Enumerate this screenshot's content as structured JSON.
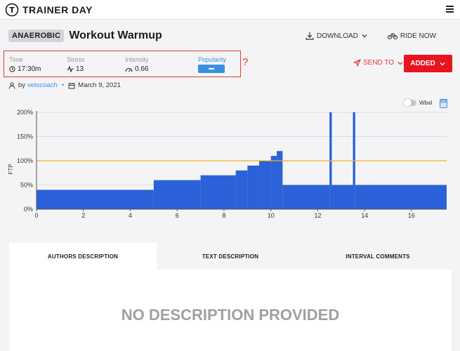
{
  "app": {
    "brand": "TRAINER DAY",
    "logo_letter": "T",
    "brand_color": "#1b1b1b",
    "accent_color": "#e8141f"
  },
  "workout": {
    "category": "ANAEROBIC",
    "title": "Workout Warmup",
    "author_prefix": "by",
    "author": "velocoach",
    "date": "March 9, 2021"
  },
  "actions": {
    "download": "DOWNLOAD",
    "ride_now": "RIDE NOW",
    "send_to": "SEND TO",
    "added": "ADDED"
  },
  "stats": {
    "time_label": "Time",
    "time_value": "17:30m",
    "stress_label": "Stress",
    "stress_value": "13",
    "intensity_label": "Intensity",
    "intensity_value": "0.66",
    "popularity_label": "Popularity",
    "annotation": "?"
  },
  "wbal": {
    "label": "Wbal",
    "enabled": false
  },
  "tabs": [
    {
      "label": "AUTHORS DESCRIPTION",
      "active": true
    },
    {
      "label": "TEXT DESCRIPTION",
      "active": false
    },
    {
      "label": "INTERVAL COMMENTS",
      "active": false
    }
  ],
  "description": {
    "empty_text": "NO DESCRIPTION PROVIDED"
  },
  "icons": [
    "download-icon",
    "bike-icon",
    "send-icon",
    "user-icon",
    "calendar-icon",
    "clock-icon",
    "pulse-icon",
    "gauge-icon",
    "calculator-icon",
    "menu-icon",
    "chevron-down-icon"
  ],
  "chart_data": {
    "type": "area",
    "ylabel": "FTP",
    "xlim": [
      0,
      17.5
    ],
    "ylim": [
      0,
      200
    ],
    "x_ticks": [
      0,
      2,
      4,
      6,
      8,
      10,
      12,
      14,
      16
    ],
    "y_ticks": [
      {
        "value": 0,
        "label": "0%"
      },
      {
        "value": 50,
        "label": "50%"
      },
      {
        "value": 100,
        "label": "100%"
      },
      {
        "value": 150,
        "label": "150%"
      },
      {
        "value": 200,
        "label": "200%"
      }
    ],
    "ftp_line": 100,
    "grid": true,
    "bar_color": "#2b62d9",
    "ftp_line_color": "#f2b01e",
    "intervals": [
      {
        "start": 0,
        "end": 5,
        "power": 40
      },
      {
        "start": 5,
        "end": 7,
        "power": 60
      },
      {
        "start": 7,
        "end": 8.5,
        "power": 70
      },
      {
        "start": 8.5,
        "end": 9,
        "power": 80
      },
      {
        "start": 9,
        "end": 9.5,
        "power": 90
      },
      {
        "start": 9.5,
        "end": 10,
        "power": 100
      },
      {
        "start": 10,
        "end": 10.25,
        "power": 110
      },
      {
        "start": 10.25,
        "end": 10.5,
        "power": 120
      },
      {
        "start": 10.5,
        "end": 12.5,
        "power": 50
      },
      {
        "start": 12.5,
        "end": 12.6,
        "power": 200
      },
      {
        "start": 12.6,
        "end": 13.5,
        "power": 50
      },
      {
        "start": 13.5,
        "end": 13.6,
        "power": 200
      },
      {
        "start": 13.6,
        "end": 17.5,
        "power": 50
      }
    ]
  }
}
